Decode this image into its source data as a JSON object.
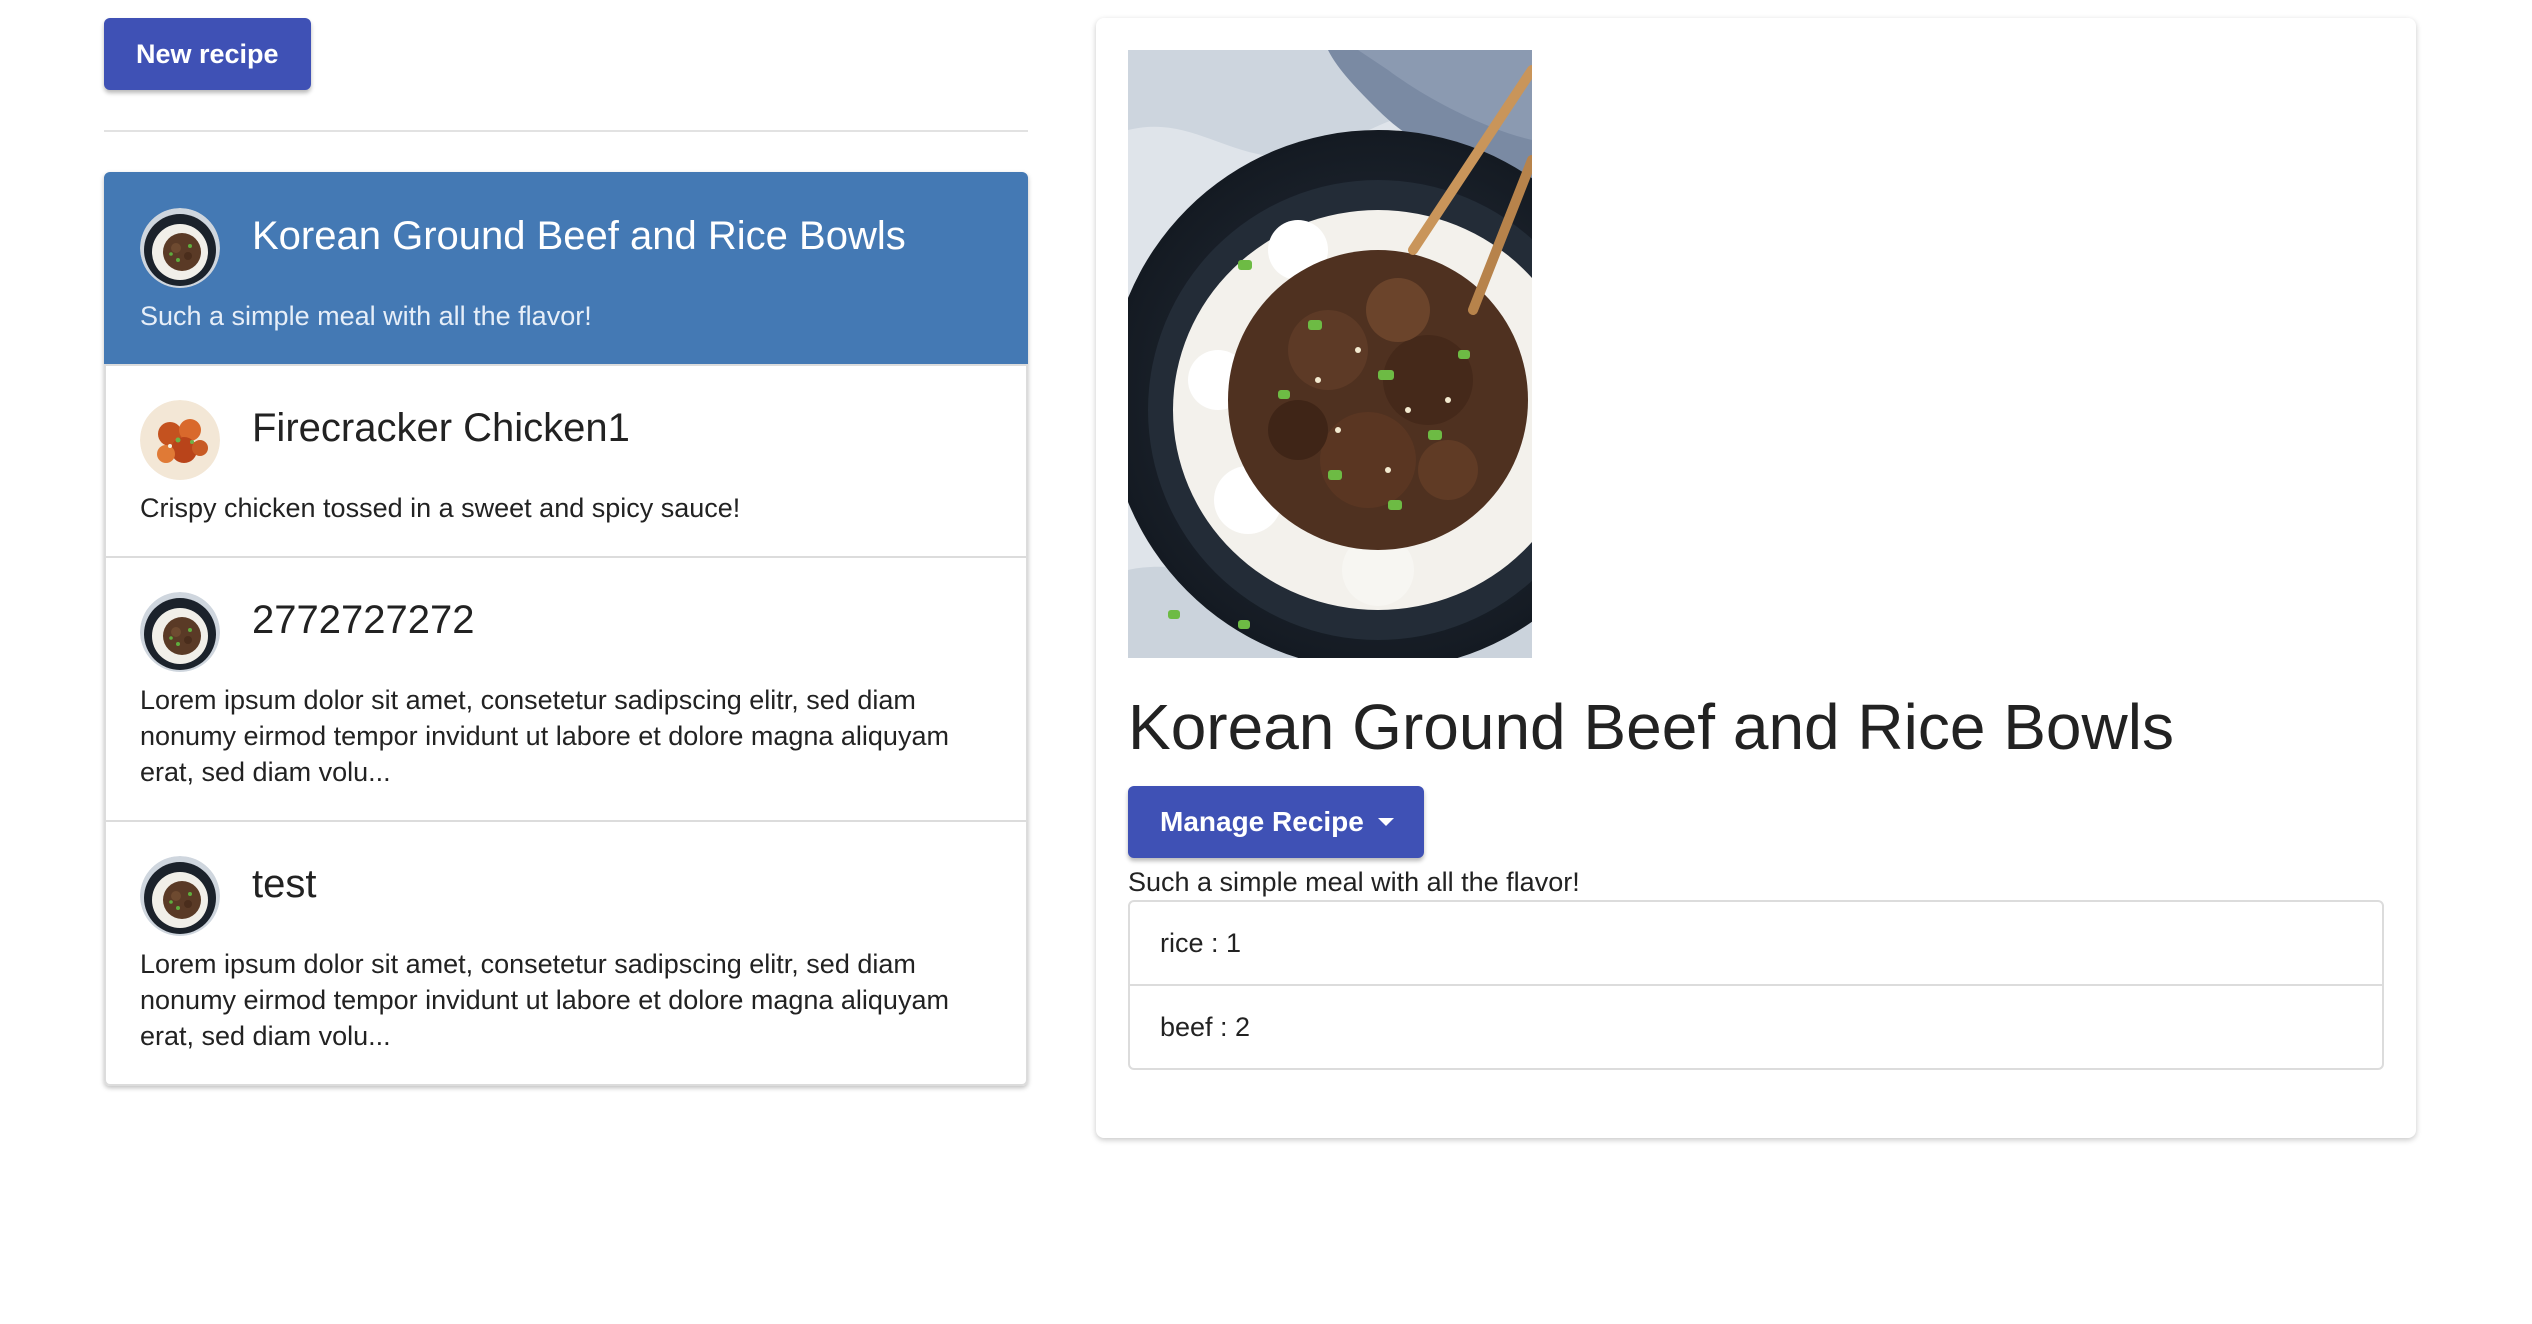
{
  "toolbar": {
    "new_recipe_label": "New recipe"
  },
  "recipes": [
    {
      "name": "Korean Ground Beef and Rice Bowls",
      "description": "Such a simple meal with all the flavor!",
      "thumbnail": "beef-rice-bowl",
      "active": true
    },
    {
      "name": "Firecracker Chicken1",
      "description": "Crispy chicken tossed in a sweet and spicy sauce!",
      "thumbnail": "firecracker-chicken",
      "active": false
    },
    {
      "name": "2772727272",
      "description": "Lorem ipsum dolor sit amet, consetetur sadipscing elitr, sed diam nonumy eirmod tempor invidunt ut labore et dolore magna aliquyam erat, sed diam volu...",
      "thumbnail": "beef-rice-bowl",
      "active": false
    },
    {
      "name": "test",
      "description": "Lorem ipsum dolor sit amet, consetetur sadipscing elitr, sed diam nonumy eirmod tempor invidunt ut labore et dolore magna aliquyam erat, sed diam volu...",
      "thumbnail": "beef-rice-bowl",
      "active": false
    }
  ],
  "detail": {
    "image": "beef-rice-bowl",
    "title": "Korean Ground Beef and Rice Bowls",
    "manage_label": "Manage Recipe",
    "description": "Such a simple meal with all the flavor!",
    "ingredients": [
      "rice : 1",
      "beef : 2"
    ]
  },
  "colors": {
    "primary": "#3f51b5",
    "active_card": "#4479b4"
  }
}
